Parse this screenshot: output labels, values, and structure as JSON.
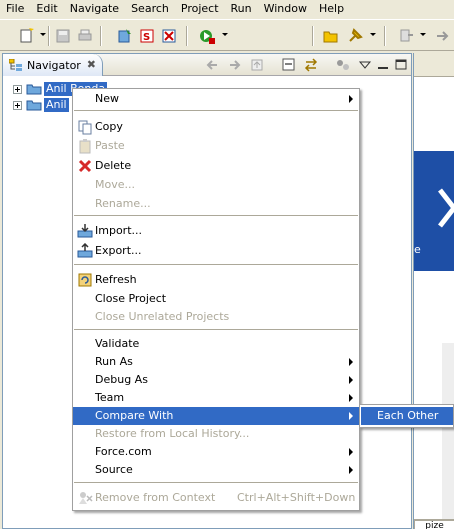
{
  "menubar": {
    "items": [
      "File",
      "Edit",
      "Navigate",
      "Search",
      "Project",
      "Run",
      "Window",
      "Help"
    ]
  },
  "toolbar": {
    "icons": [
      "new-icon",
      "save-icon",
      "print-icon",
      "build-icon",
      "s-icon",
      "x-icon",
      "run-icon",
      "open-folder-icon",
      "pin-icon",
      "nav-back-icon",
      "nav-forward-icon"
    ]
  },
  "navigator": {
    "tab_label": "Navigator",
    "close_glyph": "✖",
    "tree": [
      {
        "label": "Anil Bonda"
      },
      {
        "label": "Anil"
      }
    ]
  },
  "context_menu": {
    "items": [
      {
        "label": "New",
        "has_submenu": true,
        "enabled": true,
        "icon": ""
      },
      {
        "separator": true
      },
      {
        "label": "Copy",
        "enabled": true,
        "icon": "copy-icon"
      },
      {
        "label": "Paste",
        "enabled": false,
        "icon": "paste-icon"
      },
      {
        "label": "Delete",
        "enabled": true,
        "icon": "delete-icon"
      },
      {
        "label": "Move...",
        "enabled": false
      },
      {
        "label": "Rename...",
        "enabled": false
      },
      {
        "separator": true
      },
      {
        "label": "Import...",
        "enabled": true,
        "icon": "import-icon"
      },
      {
        "label": "Export...",
        "enabled": true,
        "icon": "export-icon"
      },
      {
        "separator": true
      },
      {
        "label": "Refresh",
        "enabled": true,
        "icon": "refresh-icon"
      },
      {
        "label": "Close Project",
        "enabled": true
      },
      {
        "label": "Close Unrelated Projects",
        "enabled": false
      },
      {
        "separator": true
      },
      {
        "label": "Validate",
        "enabled": true
      },
      {
        "label": "Run As",
        "has_submenu": true,
        "enabled": true
      },
      {
        "label": "Debug As",
        "has_submenu": true,
        "enabled": true
      },
      {
        "label": "Team",
        "has_submenu": true,
        "enabled": true
      },
      {
        "label": "Compare With",
        "has_submenu": true,
        "enabled": true,
        "selected": true
      },
      {
        "label": "Restore from Local History...",
        "enabled": false
      },
      {
        "label": "Force.com",
        "has_submenu": true,
        "enabled": true
      },
      {
        "label": "Source",
        "has_submenu": true,
        "enabled": true
      },
      {
        "separator": true
      },
      {
        "label": "Remove from Context",
        "accelerator": "Ctrl+Alt+Shift+Down",
        "enabled": false,
        "icon": "remove-context-icon"
      }
    ]
  },
  "submenu": {
    "items": [
      {
        "label": "Each Other",
        "selected": true
      }
    ]
  },
  "editor": {
    "partial_text": "e",
    "bottom_tab": "pize"
  },
  "colors": {
    "selection": "#316ac5",
    "disabled_text": "#aca899",
    "chrome": "#ece9d8",
    "banner": "#1e4fa6"
  }
}
